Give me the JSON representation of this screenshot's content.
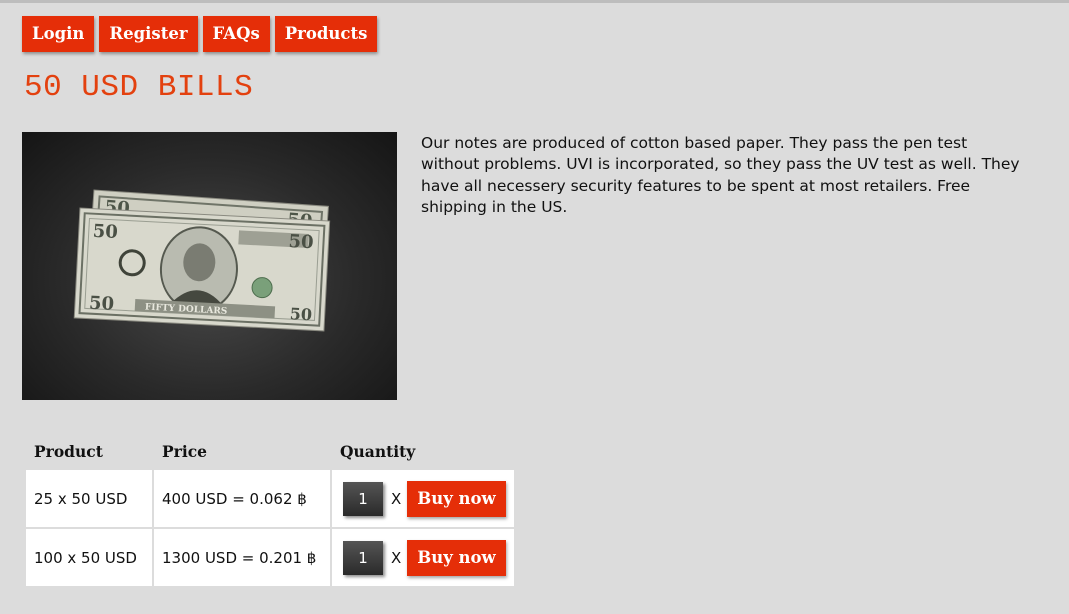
{
  "nav": {
    "items": [
      {
        "label": "Login"
      },
      {
        "label": "Register"
      },
      {
        "label": "FAQs"
      },
      {
        "label": "Products"
      }
    ]
  },
  "page": {
    "title": "50 USD BILLS",
    "description": "Our notes are produced of cotton based paper. They pass the pen test without problems. UVI is incorporated, so they pass the UV test as well. They have all necessery security features to be spent at most retailers. Free shipping in the US."
  },
  "photo": {
    "subject": "two fifty dollar banknotes on dark surface",
    "corner_numeral": "50",
    "ribbon_text": "FIFTY DOLLARS"
  },
  "table": {
    "headers": {
      "product": "Product",
      "price": "Price",
      "quantity": "Quantity"
    },
    "rows": [
      {
        "product": "25 x 50 USD",
        "price": "400 USD = 0.062 ฿",
        "quantity": "1",
        "times": "X",
        "buy_label": "Buy now"
      },
      {
        "product": "100 x 50 USD",
        "price": "1300 USD = 0.201 ฿",
        "quantity": "1",
        "times": "X",
        "buy_label": "Buy now"
      }
    ]
  },
  "colors": {
    "accent": "#e52e08",
    "title": "#e3410f",
    "background": "#dcdcdc"
  }
}
